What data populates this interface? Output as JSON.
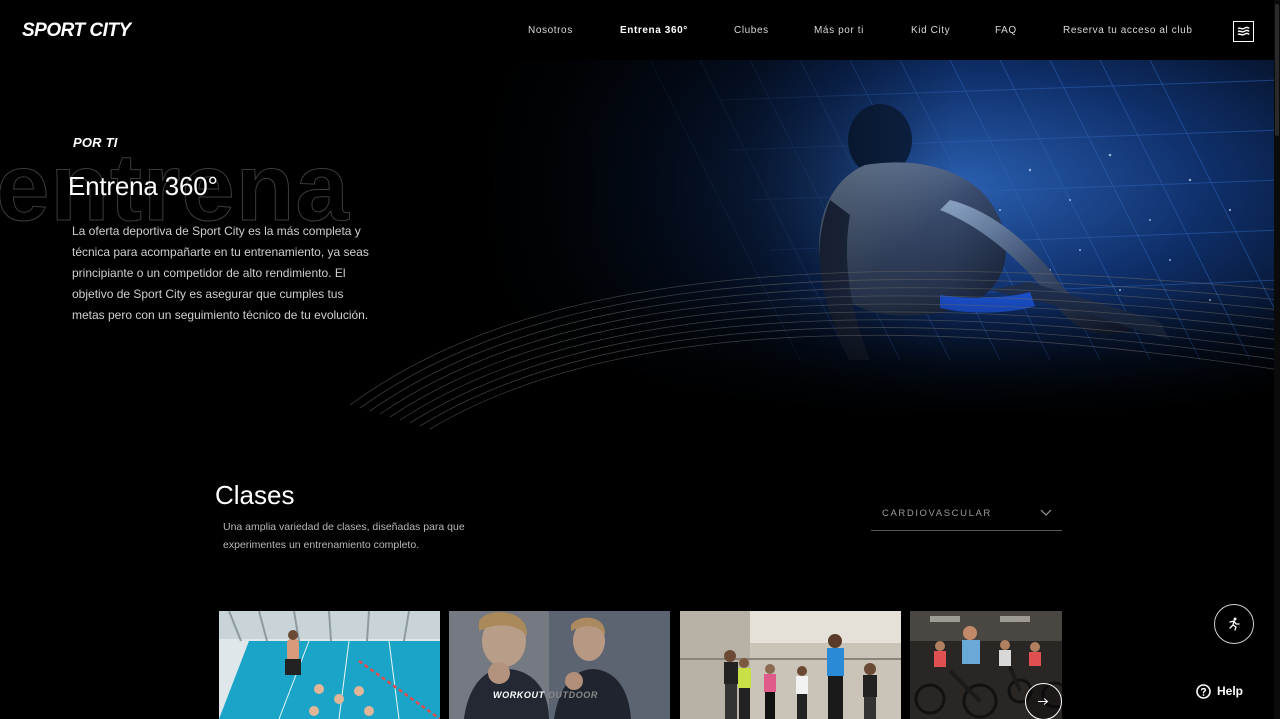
{
  "header": {
    "logo": "SPORT CITY",
    "nav": [
      {
        "label": "Nosotros",
        "active": false
      },
      {
        "label": "Entrena 360°",
        "active": true
      },
      {
        "label": "Clubes",
        "active": false
      },
      {
        "label": "Más por ti",
        "active": false
      },
      {
        "label": "Kid City",
        "active": false
      },
      {
        "label": "FAQ",
        "active": false
      },
      {
        "label": "Reserva tu acceso al club",
        "active": false
      }
    ],
    "menu_icon": "wave-menu-icon"
  },
  "hero": {
    "watermark": "entrena",
    "eyebrow": "POR TI",
    "title": "Entrena 360°",
    "text": "La oferta deportiva de Sport City es la más completa y técnica para acompañarte en tu entrenamiento, ya seas principiante o un competidor de alto rendimiento. El objetivo de Sport City es asegurar que cumples tus metas pero con un seguimiento técnico de tu evolución.",
    "image": "swimmer-underwater"
  },
  "classes": {
    "title": "Clases",
    "description": "Una amplia variedad de clases, diseñadas para que experimentes un entrenamiento completo.",
    "filter_value": "CARDIOVASCULAR",
    "cards": [
      {
        "image": "pool-aquafitness"
      },
      {
        "image": "workout-outdoor",
        "brand_main": "WORKOUT",
        "brand_dim": "OUTDOOR"
      },
      {
        "image": "kickboxing-class"
      },
      {
        "image": "indoor-cycling"
      }
    ]
  },
  "widgets": {
    "help_label": "Help",
    "colors": {
      "background": "#000000",
      "text": "#ffffff",
      "muted": "#cfcfcf",
      "pool": "#1aa5c8"
    }
  }
}
